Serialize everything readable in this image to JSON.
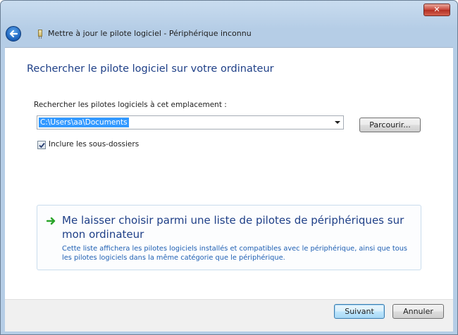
{
  "window": {
    "title": "Mettre à jour le pilote logiciel - Périphérique inconnu",
    "close_glyph": "✕"
  },
  "content": {
    "heading": "Rechercher le pilote logiciel sur votre ordinateur",
    "location_label": "Rechercher les pilotes logiciels à cet emplacement :",
    "location_value": "C:\\Users\\aa\\Documents",
    "browse_label": "Parcourir...",
    "include_subfolders_label": "Inclure les sous-dossiers",
    "include_subfolders_checked": true,
    "option": {
      "title": "Me laisser choisir parmi une liste de pilotes de périphériques sur mon ordinateur",
      "description": "Cette liste affichera les pilotes logiciels installés et compatibles avec le périphérique, ainsi que tous les pilotes logiciels dans la même catégorie que le périphérique."
    }
  },
  "footer": {
    "next_label": "Suivant",
    "cancel_label": "Annuler"
  },
  "icons": {
    "back": "back-arrow-icon",
    "device": "device-icon",
    "option_arrow": "green-arrow-icon",
    "checkmark": "checkmark-icon"
  },
  "colors": {
    "heading": "#1e3f87",
    "link_description": "#1e5fb3",
    "selection": "#3399ff",
    "option_arrow": "#2aa52a"
  }
}
